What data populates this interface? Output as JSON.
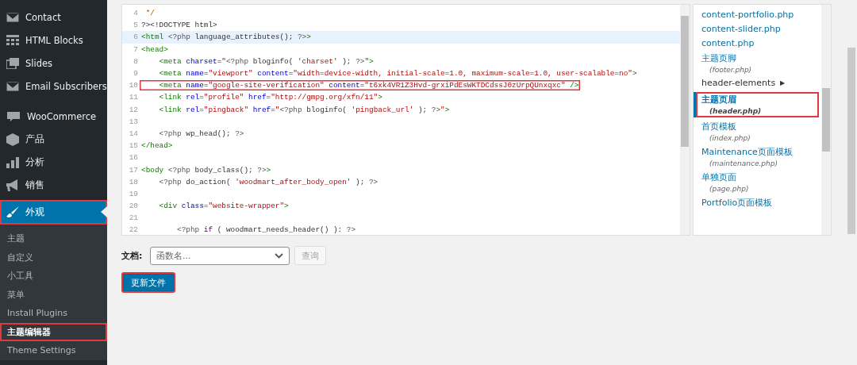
{
  "sidebar": {
    "items": [
      {
        "label": "Contact",
        "selected": false,
        "outlined": false
      },
      {
        "label": "HTML Blocks",
        "selected": false,
        "outlined": false
      },
      {
        "label": "Slides",
        "selected": false,
        "outlined": false
      },
      {
        "label": "Email Subscribers",
        "selected": false,
        "outlined": false
      },
      {
        "label": "WooCommerce",
        "selected": false,
        "outlined": false
      },
      {
        "label": "产品",
        "selected": false,
        "outlined": false
      },
      {
        "label": "分析",
        "selected": false,
        "outlined": false
      },
      {
        "label": "销售",
        "selected": false,
        "outlined": false
      },
      {
        "label": "外观",
        "selected": true,
        "outlined": true,
        "children": [
          {
            "label": "主题",
            "selected": false,
            "outlined": false
          },
          {
            "label": "自定义",
            "selected": false,
            "outlined": false
          },
          {
            "label": "小工具",
            "selected": false,
            "outlined": false
          },
          {
            "label": "菜单",
            "selected": false,
            "outlined": false
          },
          {
            "label": "Install Plugins",
            "selected": false,
            "outlined": false
          },
          {
            "label": "主题编辑器",
            "selected": true,
            "outlined": true
          },
          {
            "label": "Theme Settings",
            "selected": false,
            "outlined": false
          }
        ]
      }
    ]
  },
  "editor": {
    "lines": [
      {
        "number": "4",
        "active": false,
        "outlined": false,
        "tokens": [
          {
            "kind": "comment",
            "text": " */"
          }
        ]
      },
      {
        "number": "5",
        "active": false,
        "outlined": false,
        "tokens": [
          {
            "kind": "plain",
            "text": "?><!DOCTYPE html>"
          }
        ]
      },
      {
        "number": "6",
        "active": true,
        "outlined": false,
        "tokens": [
          {
            "kind": "tag",
            "text": "<html"
          },
          {
            "kind": "php",
            "text": " <?php"
          },
          {
            "kind": "plain",
            "text": " language_attributes(); "
          },
          {
            "kind": "php",
            "text": "?>"
          },
          {
            "kind": "tag",
            "text": ">"
          }
        ]
      },
      {
        "number": "7",
        "active": false,
        "outlined": false,
        "tokens": [
          {
            "kind": "tag",
            "text": "<head>"
          }
        ]
      },
      {
        "number": "8",
        "active": false,
        "outlined": false,
        "tokens": [
          {
            "kind": "tag",
            "text": "    <meta"
          },
          {
            "kind": "attr",
            "text": " charset"
          },
          {
            "kind": "plain",
            "text": "="
          },
          {
            "kind": "string",
            "text": "\""
          },
          {
            "kind": "php",
            "text": "<?php"
          },
          {
            "kind": "plain",
            "text": " bloginfo( "
          },
          {
            "kind": "string",
            "text": "'charset'"
          },
          {
            "kind": "plain",
            "text": " ); "
          },
          {
            "kind": "php",
            "text": "?>"
          },
          {
            "kind": "string",
            "text": "\""
          },
          {
            "kind": "tag",
            "text": ">"
          }
        ]
      },
      {
        "number": "9",
        "active": false,
        "outlined": false,
        "tokens": [
          {
            "kind": "tag",
            "text": "    <meta"
          },
          {
            "kind": "attr",
            "text": " name"
          },
          {
            "kind": "plain",
            "text": "="
          },
          {
            "kind": "string",
            "text": "\"viewport\""
          },
          {
            "kind": "attr",
            "text": " content"
          },
          {
            "kind": "plain",
            "text": "="
          },
          {
            "kind": "string",
            "text": "\"width=device-width, initial-scale=1.0, maximum-scale=1.0, user-scalable=no\""
          },
          {
            "kind": "tag",
            "text": ">"
          }
        ]
      },
      {
        "number": "10",
        "active": false,
        "outlined": true,
        "tokens": [
          {
            "kind": "tag",
            "text": "    <meta"
          },
          {
            "kind": "attr",
            "text": " name"
          },
          {
            "kind": "plain",
            "text": "="
          },
          {
            "kind": "string",
            "text": "\"google-site-verification\""
          },
          {
            "kind": "attr",
            "text": " content"
          },
          {
            "kind": "plain",
            "text": "="
          },
          {
            "kind": "string",
            "text": "\"t6xk4VR1Z3Hvd-grxiPdEsWKTDCdssJ0zUrpQUnxqxc\""
          },
          {
            "kind": "tag",
            "text": " />"
          }
        ]
      },
      {
        "number": "11",
        "active": false,
        "outlined": false,
        "tokens": [
          {
            "kind": "tag",
            "text": "    <link"
          },
          {
            "kind": "attr",
            "text": " rel"
          },
          {
            "kind": "plain",
            "text": "="
          },
          {
            "kind": "string",
            "text": "\"profile\""
          },
          {
            "kind": "attr",
            "text": " href"
          },
          {
            "kind": "plain",
            "text": "="
          },
          {
            "kind": "string",
            "text": "\"http://gmpg.org/xfn/11\""
          },
          {
            "kind": "tag",
            "text": ">"
          }
        ]
      },
      {
        "number": "12",
        "active": false,
        "outlined": false,
        "tokens": [
          {
            "kind": "tag",
            "text": "    <link"
          },
          {
            "kind": "attr",
            "text": " rel"
          },
          {
            "kind": "plain",
            "text": "="
          },
          {
            "kind": "string",
            "text": "\"pingback\""
          },
          {
            "kind": "attr",
            "text": " href"
          },
          {
            "kind": "plain",
            "text": "="
          },
          {
            "kind": "string",
            "text": "\""
          },
          {
            "kind": "php",
            "text": "<?php"
          },
          {
            "kind": "plain",
            "text": " bloginfo( "
          },
          {
            "kind": "string",
            "text": "'pingback_url'"
          },
          {
            "kind": "plain",
            "text": " ); "
          },
          {
            "kind": "php",
            "text": "?>"
          },
          {
            "kind": "string",
            "text": "\""
          },
          {
            "kind": "tag",
            "text": ">"
          }
        ]
      },
      {
        "number": "13",
        "active": false,
        "outlined": false
      },
      {
        "number": "14",
        "active": false,
        "outlined": false,
        "tokens": [
          {
            "kind": "php",
            "text": "    <?php"
          },
          {
            "kind": "plain",
            "text": " wp_head(); "
          },
          {
            "kind": "php",
            "text": "?>"
          }
        ]
      },
      {
        "number": "15",
        "active": false,
        "outlined": false,
        "tokens": [
          {
            "kind": "tag",
            "text": "</head>"
          }
        ]
      },
      {
        "number": "16",
        "active": false,
        "outlined": false
      },
      {
        "number": "17",
        "active": false,
        "outlined": false,
        "tokens": [
          {
            "kind": "tag",
            "text": "<body"
          },
          {
            "kind": "php",
            "text": " <?php"
          },
          {
            "kind": "plain",
            "text": " body_class(); "
          },
          {
            "kind": "php",
            "text": "?>"
          },
          {
            "kind": "tag",
            "text": ">"
          }
        ]
      },
      {
        "number": "18",
        "active": false,
        "outlined": false,
        "tokens": [
          {
            "kind": "php",
            "text": "    <?php"
          },
          {
            "kind": "plain",
            "text": " do_action( "
          },
          {
            "kind": "string",
            "text": "'woodmart_after_body_open'"
          },
          {
            "kind": "plain",
            "text": " ); "
          },
          {
            "kind": "php",
            "text": "?>"
          }
        ]
      },
      {
        "number": "19",
        "active": false,
        "outlined": false
      },
      {
        "number": "20",
        "active": false,
        "outlined": false,
        "tokens": [
          {
            "kind": "tag",
            "text": "    <div"
          },
          {
            "kind": "attr",
            "text": " class"
          },
          {
            "kind": "plain",
            "text": "="
          },
          {
            "kind": "string",
            "text": "\"website-wrapper\""
          },
          {
            "kind": "tag",
            "text": ">"
          }
        ]
      },
      {
        "number": "21",
        "active": false,
        "outlined": false
      },
      {
        "number": "22",
        "active": false,
        "outlined": false,
        "tokens": [
          {
            "kind": "php",
            "text": "        <?php"
          },
          {
            "kind": "keyword",
            "text": " if"
          },
          {
            "kind": "plain",
            "text": " ( woodmart_needs_header() ): "
          },
          {
            "kind": "php",
            "text": "?>"
          }
        ]
      }
    ]
  },
  "files": [
    {
      "kind": "file",
      "label": "content-portfolio.php",
      "selected": false,
      "outlined": false
    },
    {
      "kind": "file",
      "label": "content-slider.php",
      "selected": false,
      "outlined": false
    },
    {
      "kind": "file",
      "label": "content.php",
      "selected": false,
      "outlined": false
    },
    {
      "kind": "template",
      "label": "主题页脚",
      "filename": "(footer.php)",
      "selected": false,
      "outlined": false
    },
    {
      "kind": "folder",
      "label": "header-elements",
      "arrow": "▶",
      "selected": false,
      "outlined": false
    },
    {
      "kind": "template",
      "label": "主题页眉",
      "filename": "(header.php)",
      "selected": true,
      "outlined": true
    },
    {
      "kind": "template",
      "label": "首页模板",
      "filename": "(index.php)",
      "selected": false,
      "outlined": false
    },
    {
      "kind": "template",
      "label": "Maintenance页面模板",
      "filename": "(maintenance.php)",
      "selected": false,
      "outlined": false
    },
    {
      "kind": "template",
      "label": "单独页面",
      "filename": "(page.php)",
      "selected": false,
      "outlined": false
    },
    {
      "kind": "file",
      "label": "Portfolio页面模板",
      "selected": false,
      "outlined": false
    }
  ],
  "documentation": {
    "label": "文档:",
    "placeholder": "函数名...",
    "lookup_button": {
      "label": "查询",
      "disabled": true
    }
  },
  "update_button": {
    "label": "更新文件",
    "outlined": true
  }
}
